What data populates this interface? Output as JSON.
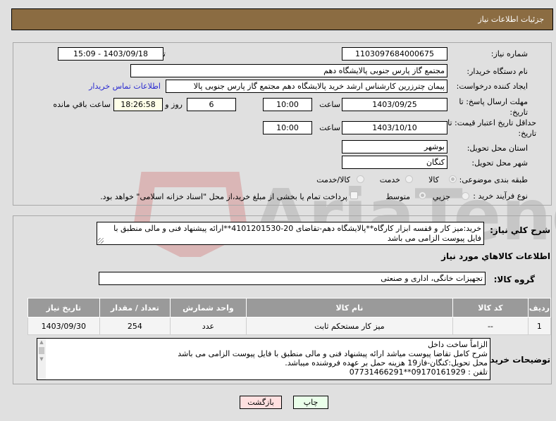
{
  "header": {
    "title": "جزئیات اطلاعات نیاز"
  },
  "form": {
    "need_number_label": "شماره نیاز:",
    "need_number": "1103097684000675",
    "announce_label": "تاریخ و ساعت اعلان عمومي:",
    "announce_value": "1403/09/18 - 15:09",
    "buyer_org_label": "نام دستگاه خریدار:",
    "buyer_org": "مجتمع گاز پارس جنوبی  پالایشگاه دهم",
    "creator_label": "ایجاد کننده درخواست:",
    "creator": "پیمان چترزرین کارشناس ارشد خرید پالایشگاه دهم مجتمع گاز پارس جنوبی  پالا",
    "contact_link": "اطلاعات تماس خریدار",
    "deadline_label": "مهلت ارسال پاسخ: تا تاریخ:",
    "deadline_date": "1403/09/25",
    "time_label": "ساعت",
    "deadline_time": "10:00",
    "days_value": "6",
    "days_label": "روز و",
    "remaining_time": "18:26:58",
    "remaining_label": "ساعت باقي مانده",
    "validity_label": "حداقل تاریخ اعتبار قیمت: تا تاریخ:",
    "validity_date": "1403/10/10",
    "validity_time": "10:00",
    "province_label": "استان محل تحویل:",
    "province": "بوشهر",
    "city_label": "شهر محل تحویل:",
    "city": "کنگان",
    "category_label": "طبقه بندی موضوعی:",
    "category_options": [
      {
        "label": "کالا",
        "selected": true
      },
      {
        "label": "خدمت",
        "selected": false
      },
      {
        "label": "کالا/خدمت",
        "selected": false
      }
    ],
    "process_label": "نوع فرآیند خرید :",
    "process_options": [
      {
        "label": "جزیي",
        "selected": false
      },
      {
        "label": "متوسط",
        "selected": true
      }
    ],
    "treasury_checkbox_label": "پرداخت تمام یا بخشی از مبلغ خرید،از محل \"اسناد خزانه اسلامی\" خواهد بود.",
    "treasury_checked": false
  },
  "summary": {
    "label": "شرح کلي نیاز:",
    "text": "خرید:میز کار و قفسه ابزار کارگاه**پالایشگاه دهم-تقاضای 20-4101201530**ارائه پیشنهاد فنی و مالی منطبق با فایل پیوست الزامی می باشد"
  },
  "goods": {
    "section_title": "اطلاعات کالاهاي مورد نیاز",
    "group_label": "گروه کالا:",
    "group_value": "تجهیزات خانگی، اداری و صنعتی",
    "columns": [
      "ردیف",
      "کد کالا",
      "نام کالا",
      "واحد شمارش",
      "تعداد / مقدار",
      "تاریخ نیاز"
    ],
    "rows": [
      [
        "1",
        "--",
        "میز کار مستحکم ثابت",
        "عدد",
        "254",
        "1403/09/30"
      ]
    ]
  },
  "buyer_notes": {
    "label": "توضیحات خریدار:",
    "lines": [
      "الزاماً ساخت داخل",
      "شرح کامل تقاضا پیوست میاشد ارائه پیشنهاد فنی و مالی منطبق با فایل پیوست الزامی می باشد",
      "محل تحویل:کنگان-فاز19 هزینه حمل بر عهده فروشنده میباشد.",
      "تلفن : 09170161929**07731466291"
    ]
  },
  "buttons": {
    "print": "چاپ",
    "back": "بازگشت"
  },
  "colors": {
    "header_bg": "#8b6c42",
    "print_bg": "#eaffea",
    "back_bg": "#ffe0e0",
    "link": "#2a2ad0"
  }
}
